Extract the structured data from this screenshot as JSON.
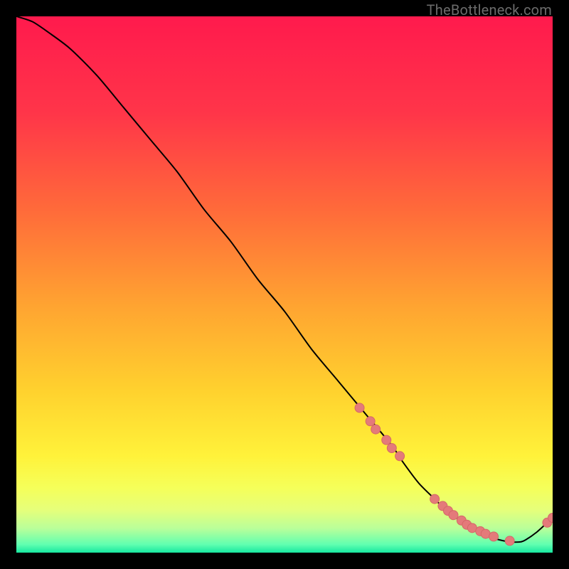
{
  "watermark": "TheBottleneck.com",
  "colors": {
    "curve": "#000000",
    "points_fill": "#e47a7a",
    "points_stroke": "#d46868",
    "gradient_stops": [
      {
        "offset": 0.0,
        "color": "#ff1a4d"
      },
      {
        "offset": 0.18,
        "color": "#ff3549"
      },
      {
        "offset": 0.36,
        "color": "#ff6a3a"
      },
      {
        "offset": 0.54,
        "color": "#ffa431"
      },
      {
        "offset": 0.7,
        "color": "#ffd22e"
      },
      {
        "offset": 0.82,
        "color": "#fff23a"
      },
      {
        "offset": 0.88,
        "color": "#f5ff5a"
      },
      {
        "offset": 0.92,
        "color": "#e6ff7a"
      },
      {
        "offset": 0.955,
        "color": "#b9ff9a"
      },
      {
        "offset": 0.985,
        "color": "#5fffb0"
      },
      {
        "offset": 1.0,
        "color": "#17e7a0"
      }
    ]
  },
  "chart_data": {
    "type": "line",
    "title": "",
    "xlabel": "",
    "ylabel": "",
    "xlim": [
      0,
      100
    ],
    "ylim": [
      0,
      100
    ],
    "series": [
      {
        "name": "bottleneck-curve",
        "x": [
          0,
          3,
          6,
          10,
          15,
          20,
          25,
          30,
          35,
          40,
          45,
          50,
          55,
          60,
          65,
          70,
          72,
          75,
          78,
          80,
          82,
          84,
          86,
          88,
          90,
          92,
          94,
          95,
          97,
          99,
          100
        ],
        "y": [
          100,
          99,
          97,
          94,
          89,
          83,
          77,
          71,
          64,
          58,
          51,
          45,
          38,
          32,
          26,
          20,
          17,
          13,
          10,
          8,
          6.5,
          5,
          4,
          3,
          2.4,
          2,
          2,
          2.4,
          3.8,
          5.6,
          6.5
        ]
      }
    ],
    "markers": {
      "name": "highlighted-points",
      "x": [
        64,
        66,
        67,
        69,
        70,
        71.5,
        78,
        79.5,
        80.5,
        81.5,
        83,
        84,
        85,
        86.5,
        87.5,
        89,
        92,
        99,
        100
      ],
      "y": [
        27,
        24.5,
        23,
        21,
        19.5,
        18,
        10,
        8.7,
        7.8,
        7.0,
        6.0,
        5.2,
        4.6,
        4.0,
        3.5,
        3.0,
        2.2,
        5.6,
        6.5
      ]
    }
  }
}
